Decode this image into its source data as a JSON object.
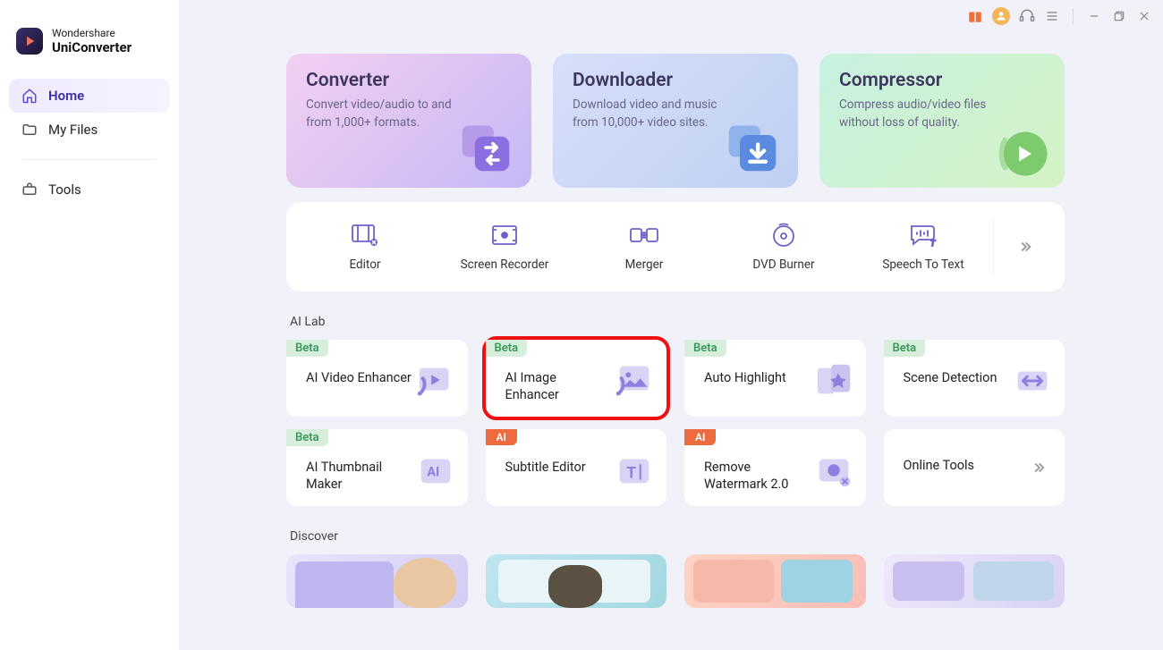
{
  "app": {
    "brand_top": "Wondershare",
    "brand_bottom": "UniConverter"
  },
  "sidebar": {
    "items": [
      {
        "label": "Home"
      },
      {
        "label": "My Files"
      },
      {
        "label": "Tools"
      }
    ]
  },
  "hero": [
    {
      "title": "Converter",
      "desc": "Convert video/audio to and from 1,000+ formats."
    },
    {
      "title": "Downloader",
      "desc": "Download video and music from 10,000+ video sites."
    },
    {
      "title": "Compressor",
      "desc": "Compress audio/video files without loss of quality."
    }
  ],
  "toolstrip": [
    {
      "label": "Editor"
    },
    {
      "label": "Screen Recorder"
    },
    {
      "label": "Merger"
    },
    {
      "label": "DVD Burner"
    },
    {
      "label": "Speech To Text"
    }
  ],
  "sections": {
    "ailab_title": "AI Lab",
    "discover_title": "Discover"
  },
  "ailab_row1": [
    {
      "badge": "Beta",
      "label": "AI Video Enhancer"
    },
    {
      "badge": "Beta",
      "label": "AI Image Enhancer"
    },
    {
      "badge": "Beta",
      "label": "Auto Highlight"
    },
    {
      "badge": "Beta",
      "label": "Scene Detection"
    }
  ],
  "ailab_row2": [
    {
      "badge": "Beta",
      "label": "AI Thumbnail Maker"
    },
    {
      "badge": "AI",
      "label": "Subtitle Editor"
    },
    {
      "badge": "AI",
      "label": "Remove Watermark 2.0"
    },
    {
      "badge": null,
      "label": "Online Tools"
    }
  ]
}
